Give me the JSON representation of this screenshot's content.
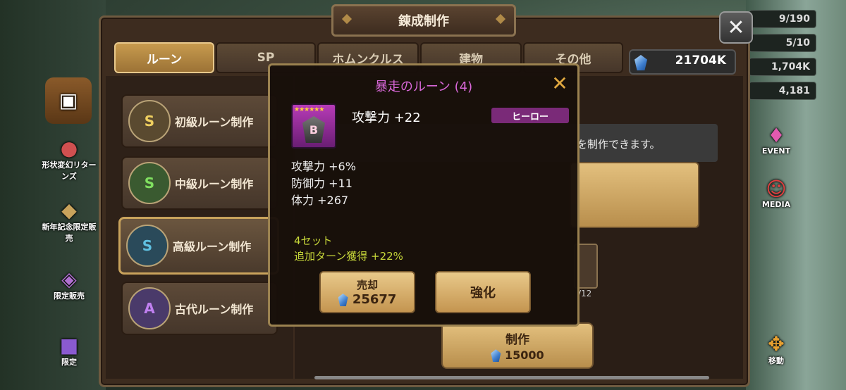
{
  "window": {
    "title": "錬成制作",
    "close_icon": "close-icon"
  },
  "tabs": [
    {
      "label": "ルーン",
      "active": true
    },
    {
      "label": "SP",
      "active": false
    },
    {
      "label": "ホムンクルス",
      "active": false
    },
    {
      "label": "建物",
      "active": false
    },
    {
      "label": "その他",
      "active": false
    }
  ],
  "currency": {
    "value": "21704K",
    "icon": "crystal-icon"
  },
  "top_right_stats": [
    "9/190",
    "5/10",
    "1,704K",
    "4,181"
  ],
  "left_sidebar": [
    {
      "label": "",
      "icon": "chest-icon"
    },
    {
      "label": "形状変幻リターンズ",
      "icon": "event-mascot-icon"
    },
    {
      "label": "新年記念限定販売",
      "icon": "gift-icon"
    },
    {
      "label": "限定販売",
      "icon": "rune-pack-icon"
    },
    {
      "label": "限定",
      "icon": "pack-icon"
    }
  ],
  "right_sidebar": [
    {
      "label": "EVENT",
      "icon": "event-gift-icon"
    },
    {
      "label": "MEDIA",
      "icon": "media-tv-icon"
    },
    {
      "label": "移動",
      "icon": "move-arrows-icon"
    }
  ],
  "rune_list": [
    {
      "label": "初級ルーン制作",
      "symbol": "S",
      "active": false
    },
    {
      "label": "中級ルーン制作",
      "symbol": "S",
      "active": false
    },
    {
      "label": "高級ルーン制作",
      "symbol": "S",
      "active": true
    },
    {
      "label": "古代ルーン制作",
      "symbol": "A",
      "active": false
    }
  ],
  "description_text": "を制作できます。",
  "material_count": "/12",
  "craft_button": {
    "label": "制作",
    "cost": "15000"
  },
  "popup": {
    "title": "暴走のルーン (4)",
    "rune_stars": "★★★★★★",
    "rune_letter": "B",
    "main_stat": "攻撃力 +22",
    "grade": "ヒーロー",
    "sub_stats": [
      {
        "name": "攻撃力",
        "value": "+6%"
      },
      {
        "name": "防御力",
        "value": "+11"
      },
      {
        "name": "体力",
        "value": "+267"
      }
    ],
    "set_count": "4セット",
    "set_effect": "追加ターン獲得 +22%",
    "sell_button": {
      "label": "売却",
      "price": "25677"
    },
    "upgrade_button": {
      "label": "強化"
    }
  },
  "colors": {
    "popup_title": "#d968d9",
    "set_text": "#c8d83a",
    "grade_badge": "#7a2a78",
    "close_x": "#e0a840"
  }
}
